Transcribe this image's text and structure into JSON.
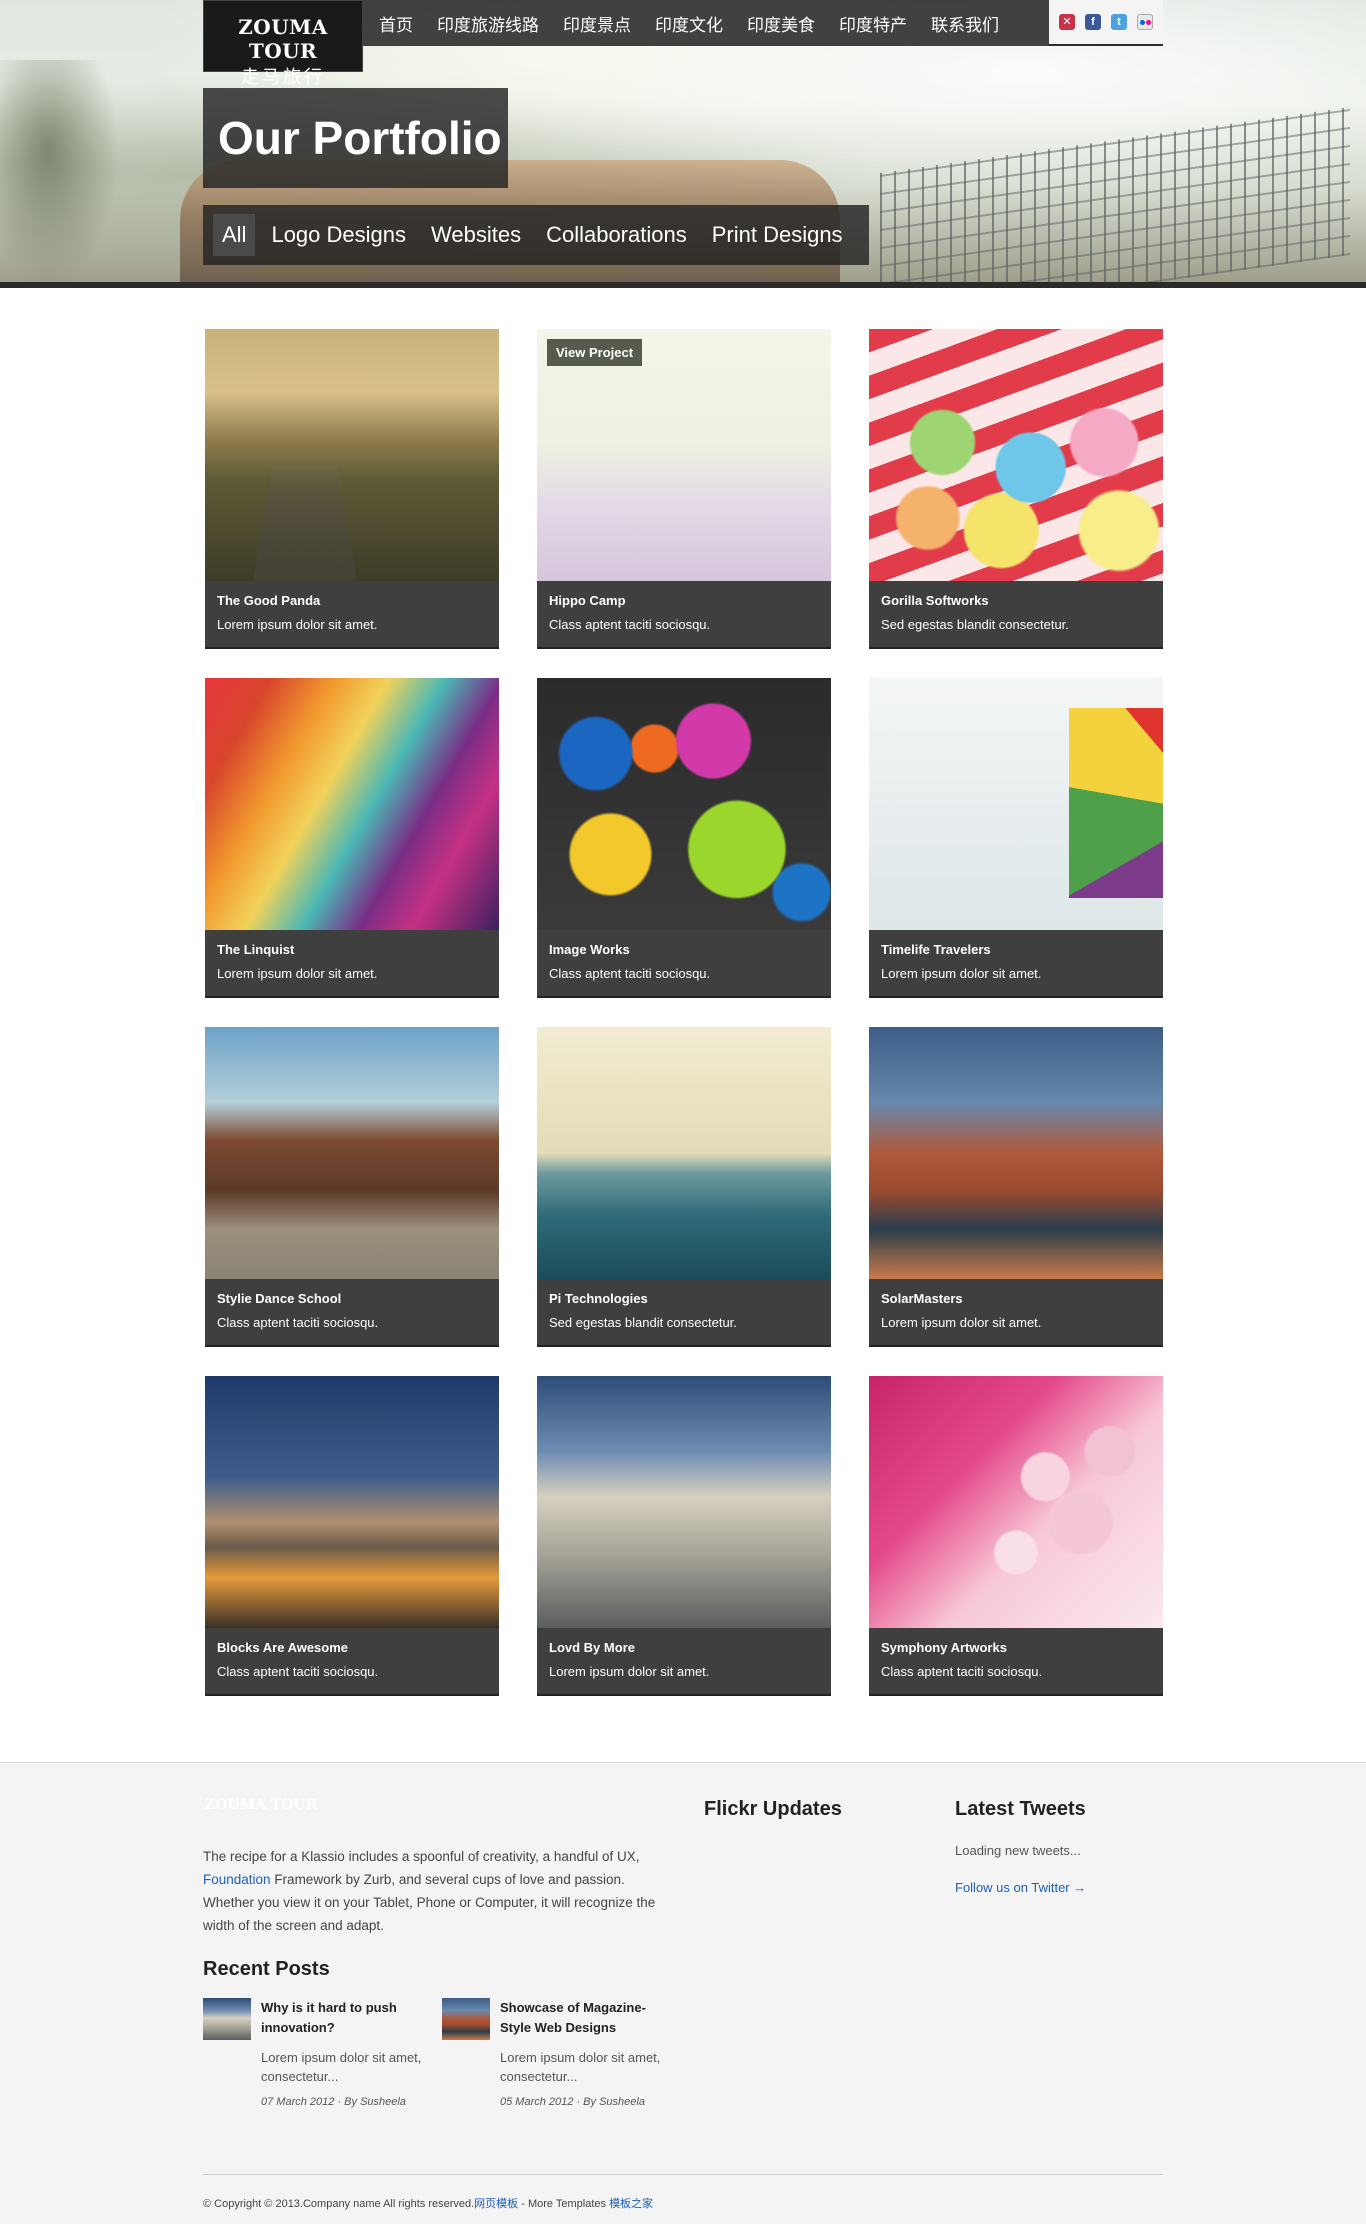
{
  "logo": {
    "en": "ZOUMA TOUR",
    "cn": "走马旅行"
  },
  "nav": [
    "首页",
    "印度旅游线路",
    "印度景点",
    "印度文化",
    "印度美食",
    "印度特产",
    "联系我们"
  ],
  "social_icons": [
    "flag-uk-icon",
    "facebook-icon",
    "twitter-icon",
    "flickr-icon"
  ],
  "page_title": "Our Portfolio",
  "filters": [
    "All",
    "Logo Designs",
    "Websites",
    "Collaborations",
    "Print Designs"
  ],
  "active_filter": "All",
  "view_project_label": "View Project",
  "portfolio": [
    {
      "title": "The Good Panda",
      "desc": "Lorem ipsum dolor sit amet."
    },
    {
      "title": "Hippo Camp",
      "desc": "Class aptent taciti sociosqu."
    },
    {
      "title": "Gorilla Softworks",
      "desc": "Sed egestas blandit consectetur."
    },
    {
      "title": "The Linquist",
      "desc": "Lorem ipsum dolor sit amet."
    },
    {
      "title": "Image Works",
      "desc": "Class aptent taciti sociosqu."
    },
    {
      "title": "Timelife Travelers",
      "desc": "Lorem ipsum dolor sit amet."
    },
    {
      "title": "Stylie Dance School",
      "desc": "Class aptent taciti sociosqu."
    },
    {
      "title": "Pi Technologies",
      "desc": "Sed egestas blandit consectetur."
    },
    {
      "title": "SolarMasters",
      "desc": "Lorem ipsum dolor sit amet."
    },
    {
      "title": "Blocks Are Awesome",
      "desc": "Class aptent taciti sociosqu."
    },
    {
      "title": "Lovd By More",
      "desc": "Lorem ipsum dolor sit amet."
    },
    {
      "title": "Symphony Artworks",
      "desc": "Class aptent taciti sociosqu."
    }
  ],
  "footer": {
    "brand": "ZOUMA TOUR",
    "about_pre": "The recipe for a Klassio includes a spoonful of creativity, a handful of UX, ",
    "about_link": "Foundation",
    "about_post": " Framework by Zurb, and several cups of love and passion. Whether you view it on your Tablet, Phone or Computer, it will recognize the width of the screen and adapt.",
    "recent_posts_heading": "Recent Posts",
    "posts": [
      {
        "title": "Why is it hard to push innovation?",
        "excerpt": "Lorem ipsum dolor sit amet, consectetur...",
        "date": "07 March 2012",
        "by": "By Susheela"
      },
      {
        "title": "Showcase of Magazine-Style Web Designs",
        "excerpt": "Lorem ipsum dolor sit amet, consectetur...",
        "date": "05 March 2012",
        "by": "By Susheela"
      }
    ],
    "flickr_heading": "Flickr Updates",
    "tweets_heading": "Latest Tweets",
    "tweets_loading": "Loading new tweets...",
    "follow_twitter": "Follow us on Twitter →",
    "copyright_text": "© Copyright © 2013.Company name All rights reserved.",
    "copyright_link1": "网页模板",
    "copyright_mid": " - More Templates ",
    "copyright_link2": "模板之家"
  }
}
